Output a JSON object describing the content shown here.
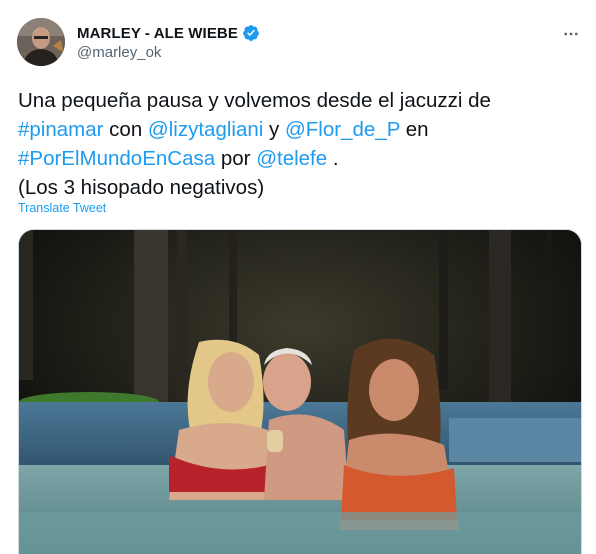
{
  "user": {
    "display_name": "MARLEY - ALE WIEBE",
    "handle": "@marley_ok",
    "verified": true
  },
  "tweet": {
    "lines": [
      [
        {
          "text": "Una pequeña pausa y volvemos desde el jacuzzi de",
          "link": false
        }
      ],
      [
        {
          "text": "#pinamar",
          "link": true
        },
        {
          "text": " con ",
          "link": false
        },
        {
          "text": "@lizytagliani",
          "link": true
        },
        {
          "text": " y ",
          "link": false
        },
        {
          "text": "@Flor_de_P",
          "link": true
        },
        {
          "text": " en",
          "link": false
        }
      ],
      [
        {
          "text": "#PorElMundoEnCasa",
          "link": true
        },
        {
          "text": " por ",
          "link": false
        },
        {
          "text": "@telefe",
          "link": true
        },
        {
          "text": " .",
          "link": false
        }
      ],
      [
        {
          "text": "(Los 3 hisopado negativos)",
          "link": false
        }
      ]
    ],
    "translate_label": "Translate Tweet"
  },
  "icons": {
    "verified": "verified-badge-icon",
    "more": "more-options-icon"
  },
  "colors": {
    "link": "#1d9bf0",
    "text": "#0f1419",
    "secondary": "#536471"
  }
}
